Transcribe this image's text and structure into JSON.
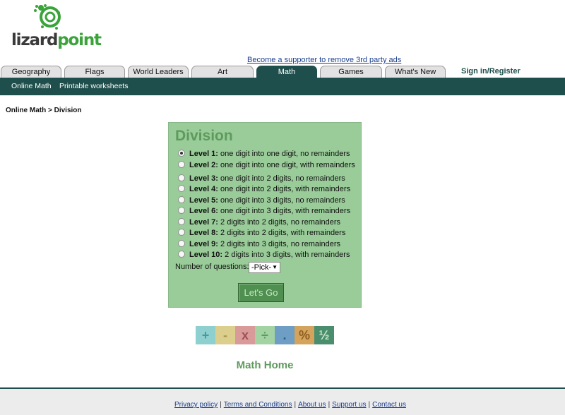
{
  "logo": {
    "text_part1": "lizard",
    "text_part2": "point"
  },
  "supporter_link": "Become a supporter to remove 3rd party ads",
  "tabs": [
    {
      "label": "Geography"
    },
    {
      "label": "Flags"
    },
    {
      "label": "World Leaders"
    },
    {
      "label": "Art"
    },
    {
      "label": "Math",
      "active": true
    },
    {
      "label": "Games"
    },
    {
      "label": "What's New"
    }
  ],
  "signin": "Sign in/Register",
  "subnav": [
    {
      "label": "Online Math"
    },
    {
      "label": "Printable worksheets"
    }
  ],
  "breadcrumb": "Online Math > Division",
  "panel": {
    "title": "Division",
    "levels": [
      {
        "name": "Level 1:",
        "desc": "one digit into one digit, no remainders",
        "checked": true
      },
      {
        "name": "Level 2:",
        "desc": "one digit into one digit, with remainders"
      },
      {
        "name": "Level 3:",
        "desc": "one digit into 2 digits, no remainders"
      },
      {
        "name": "Level 4:",
        "desc": "one digit into 2 digits, with remainders"
      },
      {
        "name": "Level 5:",
        "desc": "one digit into 3 digits, no remainders"
      },
      {
        "name": "Level 6:",
        "desc": "one digit into 3 digits, with remainders"
      },
      {
        "name": "Level 7:",
        "desc": "2 digits into 2 digits, no remainders"
      },
      {
        "name": "Level 8:",
        "desc": "2 digits into 2 digits, with remainders"
      },
      {
        "name": "Level 9:",
        "desc": "2 digits into 3 digits, no remainders"
      },
      {
        "name": "Level 10:",
        "desc": "2 digits into 3 digits, with remainders"
      }
    ],
    "num_questions_label": "Number of questions:",
    "select_value": "-Pick-",
    "go_label": "Let's Go"
  },
  "operations": [
    {
      "symbol": "+",
      "name": "addition",
      "bg": "#8ecfcf",
      "fg": "#4a9a9a"
    },
    {
      "symbol": "-",
      "name": "subtraction",
      "bg": "#dccf8e",
      "fg": "#a6964e"
    },
    {
      "symbol": "x",
      "name": "multiplication",
      "bg": "#d99a9a",
      "fg": "#a05050"
    },
    {
      "symbol": "÷",
      "name": "division",
      "bg": "#a3d3a3",
      "fg": "#5e9a5e"
    },
    {
      "symbol": ".",
      "name": "decimals",
      "bg": "#6e9ec3",
      "fg": "#2e5e8e"
    },
    {
      "symbol": "%",
      "name": "percent",
      "bg": "#d4a35e",
      "fg": "#8e5e1e"
    },
    {
      "symbol": "½",
      "name": "fractions",
      "bg": "#4a8e6e",
      "fg": "#c8e8c8"
    }
  ],
  "math_home": "Math Home",
  "footer": {
    "links": [
      {
        "label": "Privacy policy"
      },
      {
        "label": "Terms and Conditions"
      },
      {
        "label": "About us"
      },
      {
        "label": "Support us"
      },
      {
        "label": "Contact us"
      }
    ],
    "separator": "|"
  }
}
